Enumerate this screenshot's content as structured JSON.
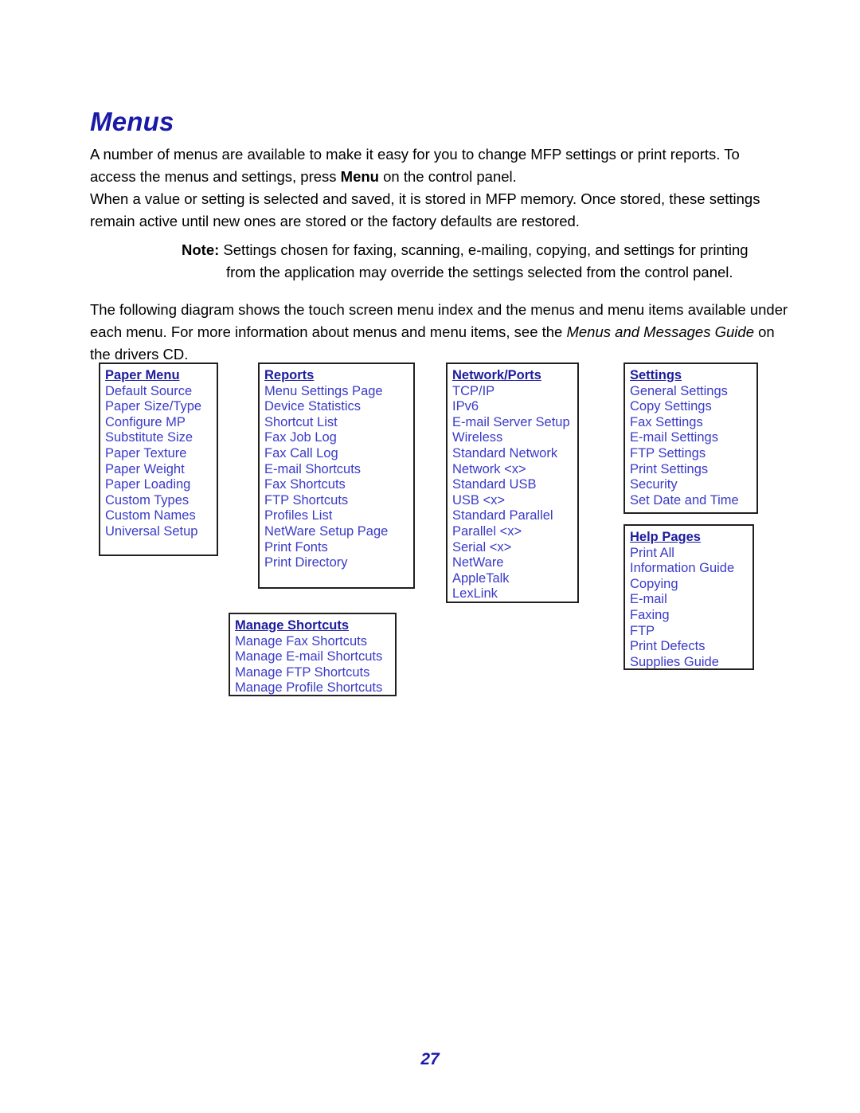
{
  "document": {
    "title": "Menus",
    "page_number": "27"
  },
  "paragraphs": {
    "p1_part1": "A number of menus are available to make it easy for you to change MFP settings or print reports. To access the menus and settings, press ",
    "p1_bold": "Menu",
    "p1_part2": " on the control panel.",
    "p2": "When a value or setting is selected and saved, it is stored in MFP memory. Once stored, these settings remain active until new ones are stored or the factory defaults are restored.",
    "note_label": "Note:",
    "note_line1": " Settings chosen for faxing, scanning, e-mailing, copying, and settings for printing",
    "note_line2": "from the application may override the settings selected from the control panel.",
    "p3_part1": "The following diagram shows the touch screen menu index and the menus and menu items available under each menu. For more information about menus and menu items, see the ",
    "p3_italic": "Menus and Messages Guide",
    "p3_part2": " on the drivers CD."
  },
  "colors": {
    "heading_blue": "#1a1aa8",
    "menu_header_blue": "#1c1c9e",
    "menu_item_blue": "#3a3ac8",
    "box_border": "#231f20"
  },
  "diagram": {
    "boxes": [
      {
        "id": "paper-menu",
        "header": "Paper Menu",
        "items": [
          "Default Source",
          "Paper Size/Type",
          "Configure MP",
          "Substitute Size",
          "Paper Texture",
          "Paper Weight",
          "Paper Loading",
          "Custom Types",
          "Custom Names",
          "Universal Setup"
        ]
      },
      {
        "id": "reports",
        "header": "Reports",
        "items": [
          "Menu Settings Page",
          "Device Statistics",
          "Shortcut List",
          "Fax Job Log",
          "Fax Call Log",
          "E-mail Shortcuts",
          "Fax Shortcuts",
          "FTP Shortcuts",
          "Profiles List",
          "NetWare Setup Page",
          "Print Fonts",
          "Print Directory"
        ]
      },
      {
        "id": "network-ports",
        "header": "Network/Ports",
        "items": [
          "TCP/IP",
          "IPv6",
          "E-mail Server Setup",
          "Wireless",
          "Standard Network",
          "Network <x>",
          "Standard USB",
          "USB <x>",
          "Standard Parallel",
          "Parallel <x>",
          "Serial <x>",
          "NetWare",
          "AppleTalk",
          "LexLink"
        ]
      },
      {
        "id": "settings",
        "header": "Settings",
        "items": [
          "General Settings",
          "Copy Settings",
          "Fax Settings",
          "E-mail Settings",
          "FTP Settings",
          "Print Settings",
          "Security",
          "Set Date and Time"
        ]
      },
      {
        "id": "help-pages",
        "header": "Help Pages",
        "items": [
          "Print All",
          "Information Guide",
          "Copying",
          "E-mail",
          "Faxing",
          "FTP",
          "Print Defects",
          "Supplies Guide"
        ]
      },
      {
        "id": "manage-shortcuts",
        "header": "Manage Shortcuts",
        "items": [
          "Manage Fax Shortcuts",
          "Manage E-mail Shortcuts",
          "Manage FTP Shortcuts",
          "Manage Profile Shortcuts"
        ]
      }
    ]
  }
}
